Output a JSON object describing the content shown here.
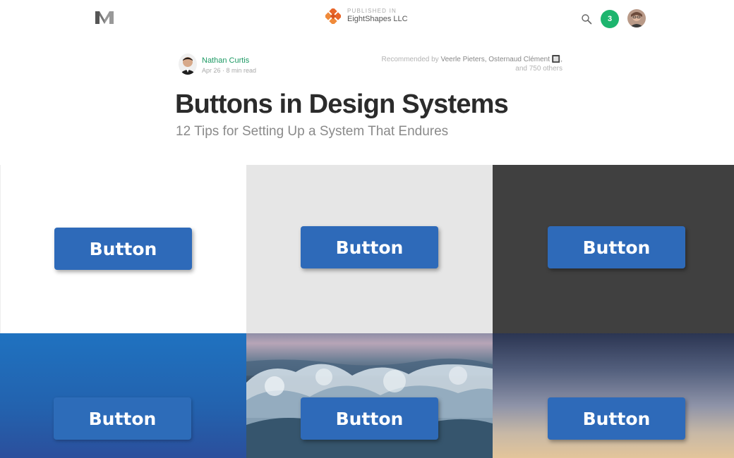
{
  "header": {
    "logo_icon": "medium-m-logo-icon",
    "publication": {
      "kicker": "PUBLISHED IN",
      "name": "EightShapes LLC",
      "logo_icon": "eightshapes-logo-icon"
    },
    "search_icon": "search-icon",
    "notification_count": "3",
    "colors": {
      "notification": "#1db56e",
      "accent": "#1c9963"
    }
  },
  "byline": {
    "author_name": "Nathan Curtis",
    "meta": "Apr 26 · 8 min read",
    "recommended_prefix": "Recommended by",
    "recommenders": "Veerle Pieters, Osternaud Clément 🔲,",
    "recommended_suffix": "and 750 others"
  },
  "article": {
    "title": "Buttons in Design Systems",
    "subtitle": "12 Tips for Setting Up a System That Endures"
  },
  "hero": {
    "button_color": "#2e6ab9",
    "buttons": [
      {
        "label": "Button",
        "background": "white"
      },
      {
        "label": "Button",
        "background": "light gray"
      },
      {
        "label": "Button",
        "background": "dark gray"
      },
      {
        "label": "Button",
        "background": "blue"
      },
      {
        "label": "Button",
        "background": "ocean wave photo"
      },
      {
        "label": "Button",
        "background": "sunset sky photo"
      }
    ]
  }
}
